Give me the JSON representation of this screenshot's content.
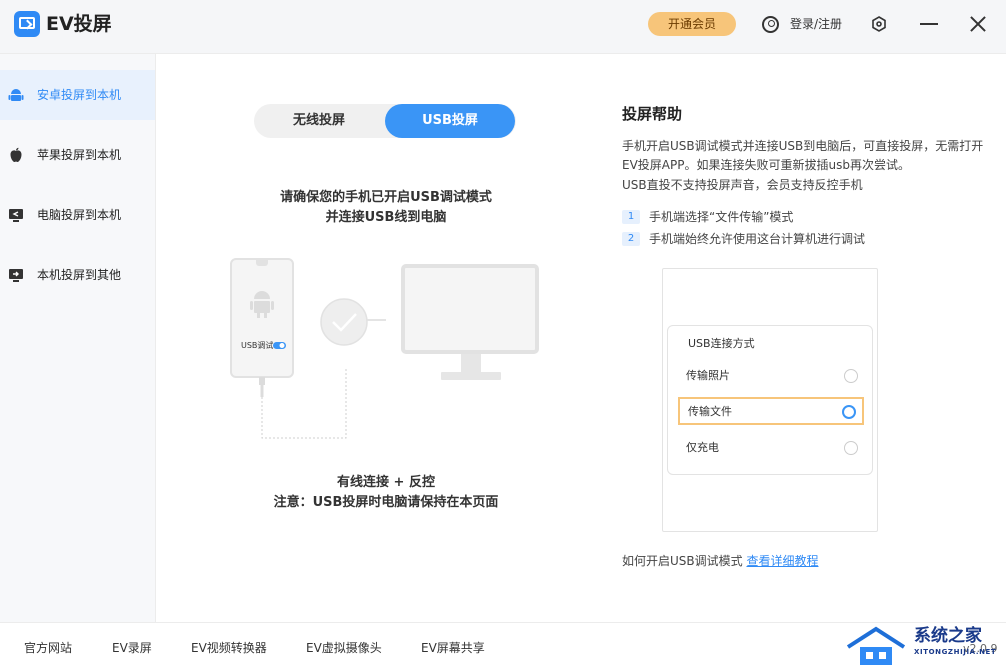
{
  "app": {
    "title": "EV投屏"
  },
  "header": {
    "vip_label": "开通会员",
    "login_label": "登录/注册"
  },
  "sidebar": {
    "items": [
      {
        "label": "安卓投屏到本机",
        "icon": "android-icon",
        "active": true
      },
      {
        "label": "苹果投屏到本机",
        "icon": "apple-icon",
        "active": false
      },
      {
        "label": "电脑投屏到本机",
        "icon": "monitor-icon",
        "active": false
      },
      {
        "label": "本机投屏到其他",
        "icon": "cast-icon",
        "active": false
      }
    ]
  },
  "main": {
    "tabs": [
      {
        "label": "无线投屏"
      },
      {
        "label": "USB投屏"
      }
    ],
    "active_tab": "USB投屏",
    "instruction_line1": "请确保您的手机已开启USB调试模式",
    "instruction_line2": "并连接USB线到电脑",
    "phone_toggle_label": "USB调试",
    "bottom_line1": "有线连接 + 反控",
    "bottom_line2": "注意：USB投屏时电脑请保持在本页面"
  },
  "help": {
    "title": "投屏帮助",
    "paragraph1": "手机开启USB调试模式并连接USB到电脑后，可直接投屏，无需打开EV投屏APP。如果连接失败可重新拔插usb再次尝试。",
    "paragraph2": "USB直投不支持投屏声音，会员支持反控手机",
    "steps": [
      {
        "num": "1",
        "text": "手机端选择“文件传输”模式"
      },
      {
        "num": "2",
        "text": "手机端始终允许使用这台计算机进行调试"
      }
    ],
    "mock": {
      "title": "USB连接方式",
      "options": [
        {
          "label": "传输照片",
          "selected": false
        },
        {
          "label": "传输文件",
          "selected": true
        },
        {
          "label": "仅充电",
          "selected": false
        }
      ]
    },
    "howto_text": "如何开启USB调试模式",
    "howto_link": "查看详细教程"
  },
  "footer": {
    "links": [
      "官方网站",
      "EV录屏",
      "EV视频转换器",
      "EV虚拟摄像头",
      "EV屏幕共享"
    ],
    "version": "v2.0.9"
  },
  "watermark": {
    "text": "系统之家",
    "sub": "XITONGZHIJIA.NET"
  },
  "colors": {
    "accent": "#3a95f6",
    "vip": "#f7c57a",
    "active_bg": "#e8f1fd"
  }
}
